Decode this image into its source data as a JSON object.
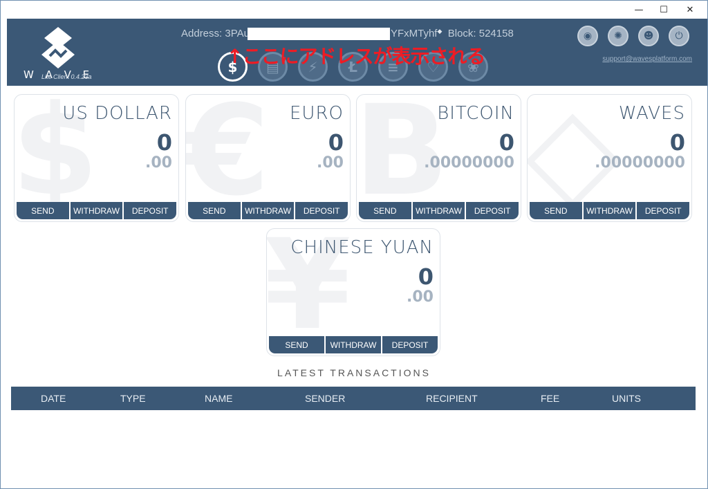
{
  "window": {
    "controls": {
      "minimize": "—",
      "maximize": "☐",
      "close": "✕"
    }
  },
  "header": {
    "logo_subtitle": "Lite Client 0.4.23a",
    "address_label": "Address: 3PAu",
    "address_suffix": "YFxMTyhf",
    "address_marker": "◆",
    "block_label": "Block: 524158",
    "annotation": "↑ここにアドレスが表示される",
    "support_link": "support@wavesplatform.com",
    "currency_icons": [
      {
        "name": "usd-icon",
        "glyph": "$",
        "active": true
      },
      {
        "name": "wallet-icon",
        "glyph": "▤",
        "active": false
      },
      {
        "name": "lightning-icon",
        "glyph": "⚡",
        "active": false
      },
      {
        "name": "litecoin-icon",
        "glyph": "Ł",
        "active": false
      },
      {
        "name": "lines-icon",
        "glyph": "≡",
        "active": false
      },
      {
        "name": "handshake-icon",
        "glyph": "♡",
        "active": false
      },
      {
        "name": "basket-icon",
        "glyph": "❀",
        "active": false
      }
    ],
    "top_icons": [
      {
        "name": "coins-icon",
        "glyph": "◉"
      },
      {
        "name": "network-icon",
        "glyph": "✺"
      },
      {
        "name": "user-icon",
        "glyph": "☻"
      },
      {
        "name": "power-icon",
        "glyph": "⏻"
      }
    ]
  },
  "cards": [
    {
      "name": "US DOLLAR",
      "bg": "$",
      "integer": "0",
      "decimal": ".00"
    },
    {
      "name": "EURO",
      "bg": "€",
      "integer": "0",
      "decimal": ".00"
    },
    {
      "name": "BITCOIN",
      "bg": "B",
      "integer": "0",
      "decimal": ".00000000"
    },
    {
      "name": "WAVES",
      "bg": "◇",
      "integer": "0",
      "decimal": ".00000000"
    },
    {
      "name": "CHINESE YUAN",
      "bg": "¥",
      "integer": "0",
      "decimal": ".00"
    }
  ],
  "card_buttons": {
    "send": "SEND",
    "withdraw": "WITHDRAW",
    "deposit": "DEPOSIT"
  },
  "transactions": {
    "title": "LATEST TRANSACTIONS",
    "columns": [
      "DATE",
      "TYPE",
      "NAME",
      "SENDER",
      "RECIPIENT",
      "FEE",
      "UNITS"
    ]
  },
  "colors": {
    "header": "#3b5876",
    "annotation": "#ee1c24"
  }
}
